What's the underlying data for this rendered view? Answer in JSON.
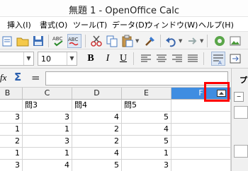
{
  "window": {
    "title": "無題 1 - OpenOffice Calc"
  },
  "menu": [
    "挿入(I)",
    "書式(O)",
    "ツール(T)",
    "データ(D)",
    "ウィンドウ(W)",
    "ヘルプ(H)"
  ],
  "toolbar_icons": [
    "insert-icon",
    "open-icon",
    "save-icon",
    "spellcheck-icon",
    "autospell-icon",
    "cut-icon",
    "copy-icon",
    "paste-icon",
    "clone-format-icon",
    "undo-icon",
    "redo-icon",
    "sort-icon",
    "navigator-icon",
    "gallery-icon"
  ],
  "format": {
    "font_size": "10",
    "bold": "B",
    "italic": "I",
    "underline": "U"
  },
  "formula": {
    "fx": "fx",
    "sum": "Σ",
    "equals": "=",
    "value": ""
  },
  "sidebar": {
    "label_fragment": "プロ"
  },
  "columns": [
    {
      "label": "B"
    },
    {
      "label": "C"
    },
    {
      "label": "D"
    },
    {
      "label": "E"
    },
    {
      "label": "F",
      "selected": true
    }
  ],
  "rows": [
    [
      "",
      "問3",
      "問4",
      "問5",
      ""
    ],
    [
      "3",
      "3",
      "4",
      "5",
      ""
    ],
    [
      "1",
      "1",
      "2",
      "4",
      ""
    ],
    [
      "2",
      "3",
      "2",
      "5",
      ""
    ],
    [
      "1",
      "1",
      "4",
      "1",
      ""
    ],
    [
      "3",
      "4",
      "5",
      "3",
      ""
    ]
  ],
  "colors": {
    "selected_column": "#3f8de1",
    "highlight_box": "#ff0000"
  }
}
